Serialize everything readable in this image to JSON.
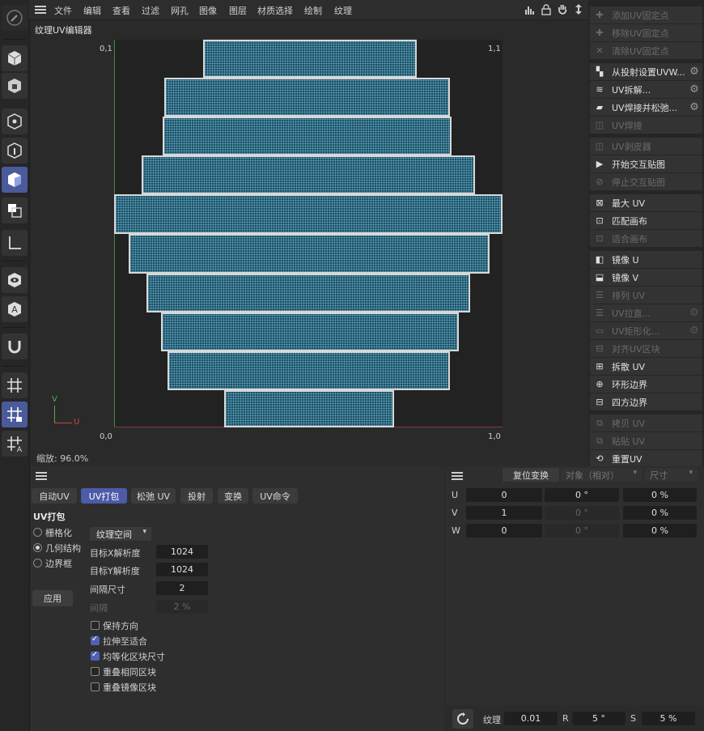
{
  "menu": [
    "文件",
    "编辑",
    "查看",
    "过滤",
    "网孔",
    "图像",
    "图层",
    "材质选择",
    "绘制",
    "纹理"
  ],
  "viewport": {
    "title": "纹理UV编辑器",
    "corner_tl": "0,1",
    "corner_tr": "1,1",
    "corner_bl": "0,0",
    "corner_br": "1,0",
    "axis_v": "V",
    "axis_u": "U",
    "zoom": "缩放: 96.0%"
  },
  "right_commands": [
    {
      "label": "添加UV固定点",
      "disabled": true,
      "icon": "pin-add-icon",
      "gear": false
    },
    {
      "label": "移除UV固定点",
      "disabled": true,
      "icon": "pin-remove-icon",
      "gear": false
    },
    {
      "label": "清除UV固定点",
      "disabled": true,
      "icon": "pin-clear-icon",
      "gear": false
    },
    {
      "label": "从投射设置UVW...",
      "disabled": false,
      "icon": "projection-icon",
      "gear": true
    },
    {
      "label": "UV拆解...",
      "disabled": false,
      "icon": "unwrap-icon",
      "gear": true
    },
    {
      "label": "UV焊接并松弛...",
      "disabled": false,
      "icon": "weld-relax-icon",
      "gear": true
    },
    {
      "label": "UV焊接",
      "disabled": true,
      "icon": "weld-icon",
      "gear": false
    },
    {
      "label": "UV剥皮器",
      "disabled": true,
      "icon": "peeler-icon",
      "gear": false
    },
    {
      "label": "开始交互贴图",
      "disabled": false,
      "icon": "play-icon",
      "gear": false
    },
    {
      "label": "停止交互贴图",
      "disabled": true,
      "icon": "stop-icon",
      "gear": false
    },
    {
      "label": "最大 UV",
      "disabled": false,
      "icon": "maximize-icon",
      "gear": false
    },
    {
      "label": "匹配画布",
      "disabled": false,
      "icon": "fit-canvas-icon",
      "gear": false
    },
    {
      "label": "适合画布",
      "disabled": true,
      "icon": "fit-icon",
      "gear": false
    },
    {
      "label": "镜像 U",
      "disabled": false,
      "icon": "mirror-u-icon",
      "gear": false
    },
    {
      "label": "镜像 V",
      "disabled": false,
      "icon": "mirror-v-icon",
      "gear": false
    },
    {
      "label": "排列 UV",
      "disabled": true,
      "icon": "arrange-icon",
      "gear": false
    },
    {
      "label": "UV拉直...",
      "disabled": true,
      "icon": "straighten-icon",
      "gear": true
    },
    {
      "label": "UV矩形化...",
      "disabled": true,
      "icon": "rectangulize-icon",
      "gear": true
    },
    {
      "label": "对齐UV区块",
      "disabled": true,
      "icon": "align-icon",
      "gear": false
    },
    {
      "label": "拆散 UV",
      "disabled": false,
      "icon": "break-icon",
      "gear": false
    },
    {
      "label": "环形边界",
      "disabled": false,
      "icon": "ring-border-icon",
      "gear": false
    },
    {
      "label": "四方边界",
      "disabled": false,
      "icon": "square-border-icon",
      "gear": false
    },
    {
      "label": "拷贝 UV",
      "disabled": true,
      "icon": "copy-icon",
      "gear": false
    },
    {
      "label": "粘贴 UV",
      "disabled": true,
      "icon": "paste-icon",
      "gear": false
    },
    {
      "label": "重置UV",
      "disabled": false,
      "icon": "reset-icon",
      "gear": false
    }
  ],
  "tabs": [
    "自动UV",
    "UV打包",
    "松弛 UV",
    "投射",
    "变换",
    "UV命令"
  ],
  "packing": {
    "heading": "UV打包",
    "methods": [
      {
        "label": "栅格化",
        "selected": false
      },
      {
        "label": "几何结构",
        "selected": true
      },
      {
        "label": "边界框",
        "selected": false
      }
    ],
    "space_dropdown": "纹理空间",
    "target_x_label": "目标X解析度",
    "target_x": "1024",
    "target_y_label": "目标Y解析度",
    "target_y": "1024",
    "spacing_size_label": "间隔尺寸",
    "spacing_size": "2",
    "spacing_label": "间隔",
    "spacing": "2 %",
    "apply": "应用",
    "options": [
      {
        "label": "保持方向",
        "checked": false
      },
      {
        "label": "拉伸至适合",
        "checked": true
      },
      {
        "label": "均等化区块尺寸",
        "checked": true
      },
      {
        "label": "重叠相同区块",
        "checked": false
      },
      {
        "label": "重叠镜像区块",
        "checked": false
      }
    ]
  },
  "transform": {
    "reset": "复位变换",
    "object_dropdown": "对象（相对）",
    "size_dropdown": "尺寸",
    "rows": [
      {
        "axis": "U",
        "pos": "0",
        "rot": "0 °",
        "scale": "0 %"
      },
      {
        "axis": "V",
        "pos": "1",
        "rot": "0 °",
        "scale": "0 %"
      },
      {
        "axis": "W",
        "pos": "0",
        "rot": "0 °",
        "scale": "0 %"
      }
    ]
  },
  "footer": {
    "texture_label": "纹理",
    "texture_value": "0.01",
    "r_label": "R",
    "r_value": "5 °",
    "s_label": "S",
    "s_value": "5 %"
  },
  "colors": {
    "accent": "#4b5ba8",
    "island_fill": "#1b4f66",
    "island_border": "#d8d8d8"
  }
}
